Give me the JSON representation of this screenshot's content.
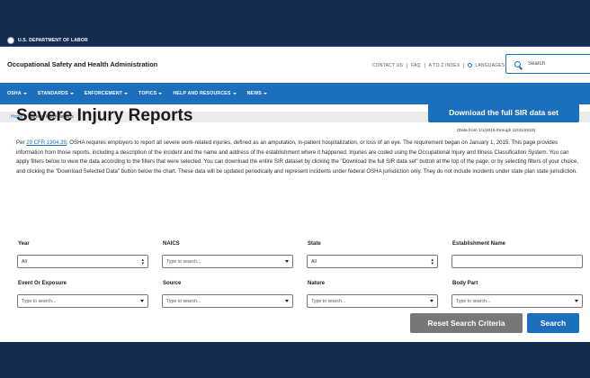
{
  "header": {
    "department": "U.S. DEPARTMENT OF LABOR",
    "agency": "Occupational Safety and Health Administration",
    "util_links": [
      "CONTACT US",
      "FAQ",
      "A TO Z INDEX"
    ],
    "languages": "LANGUAGES",
    "search_placeholder": "Search"
  },
  "nav": {
    "items": [
      "OSHA",
      "STANDARDS",
      "ENFORCEMENT",
      "TOPICS",
      "HELP AND RESOURCES",
      "NEWS"
    ]
  },
  "breadcrumb": {
    "home": "Home",
    "current": "Severe Injury Reports"
  },
  "main": {
    "title": "Severe Injury Reports",
    "download_full_label": "Download the full SIR data set",
    "date_note": "(Data from 1/1/2015 through 12/31/2023)",
    "intro_prefix": "Per ",
    "intro_link": "29 CFR 1904.39",
    "intro_text": ", OSHA requires employers to report all severe work-related injuries, defined as an amputation, in-patient hospitalization, or loss of an eye. The requirement began on January 1, 2015. This page provides information from those reports, including a description of the incident and the name and address of the establishment where it happened. Injuries are coded using the Occupational Injury and Illness Classification System. You can apply filters below to view the data according to the filters that were selected. You can download the entire SIR dataset by clicking the \"Download the full SIR data set\" button at the top of the page, or by selecting filters of your choice, and clicking the \"Download Selected Data\" button below the chart. These data will be updated periodically and represent incidents under federal OSHA jurisdiction only. They do not include incidents under state plan state jurisdiction."
  },
  "filters": {
    "year": {
      "label": "Year",
      "value": "All"
    },
    "naics": {
      "label": "NAICS",
      "placeholder": "Type to search..."
    },
    "state": {
      "label": "State",
      "value": "All"
    },
    "establishment": {
      "label": "Establishment Name",
      "value": ""
    },
    "event": {
      "label": "Event Or Exposure",
      "placeholder": "Type to search..."
    },
    "source": {
      "label": "Source",
      "placeholder": "Type to search..."
    },
    "nature": {
      "label": "Nature",
      "placeholder": "Type to search..."
    },
    "body_part": {
      "label": "Body Part",
      "placeholder": "Type to search..."
    }
  },
  "buttons": {
    "reset": "Reset Search Criteria",
    "search": "Search"
  },
  "colors": {
    "brand_navy": "#142b50",
    "nav_blue": "#1b6fbd",
    "reset_gray": "#777777"
  },
  "icons": [
    "seal-icon",
    "globe-icon",
    "search-icon",
    "chevron-down-icon",
    "up-down-arrows-icon"
  ]
}
